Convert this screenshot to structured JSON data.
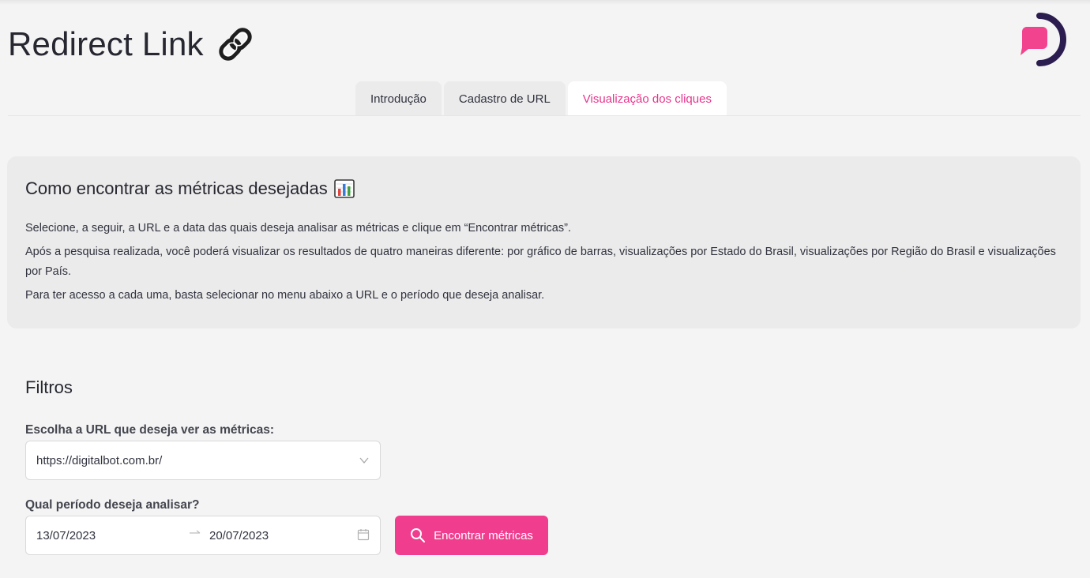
{
  "app": {
    "title": "Redirect Link",
    "title_icon": "link-emoji-icon",
    "logo_icon": "digitalbot-logo-icon"
  },
  "tabs": [
    {
      "label": "Introdução",
      "active": false
    },
    {
      "label": "Cadastro de URL",
      "active": false
    },
    {
      "label": "Visualização dos cliques",
      "active": true
    }
  ],
  "info": {
    "heading": "Como encontrar as métricas desejadas",
    "heading_icon": "bar-chart-emoji-icon",
    "paragraphs": [
      "Selecione, a seguir, a URL e a data das quais deseja analisar as métricas e clique em “Encontrar métricas”.",
      "Após a pesquisa realizada, você poderá visualizar os resultados de quatro maneiras diferente: por gráfico de barras, visualizações por Estado do Brasil, visualizações por Região do Brasil e visualizações por País.",
      "Para ter acesso a cada uma, basta selecionar no menu abaixo a URL e o período que deseja analisar."
    ]
  },
  "filters": {
    "heading": "Filtros",
    "url_label": "Escolha a URL que deseja ver as métricas:",
    "url_value": "https://digitalbot.com.br/",
    "period_label": "Qual período deseja analisar?",
    "start_date": "13/07/2023",
    "end_date": "20/07/2023",
    "button_label": "Encontrar métricas"
  },
  "colors": {
    "accent": "#e8348c",
    "button": "#f03d8e",
    "logo_dark": "#2b1d4f",
    "background": "#f4f4f4"
  }
}
